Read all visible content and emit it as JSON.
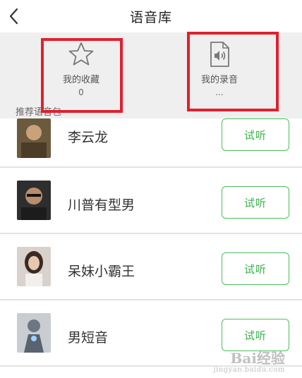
{
  "header": {
    "title": "语音库",
    "back_icon": "chevron-left-icon"
  },
  "top": {
    "favorites": {
      "icon": "star-icon",
      "label": "我的收藏",
      "count": "0"
    },
    "recordings": {
      "icon": "audio-file-icon",
      "label": "我的录音",
      "count": "..."
    }
  },
  "section": {
    "title": "推荐语音包"
  },
  "packs": [
    {
      "name": "李云龙",
      "button": "试听"
    },
    {
      "name": "川普有型男",
      "button": "试听"
    },
    {
      "name": "呆妹小霸王",
      "button": "试听"
    },
    {
      "name": "男短音",
      "button": "试听"
    }
  ],
  "watermark": {
    "logo": "Bai经验",
    "url": "jingyan.baidu.com"
  },
  "colors": {
    "accent_green": "#38b24a",
    "highlight_red": "#e0202e",
    "panel_gray": "#efefef"
  }
}
